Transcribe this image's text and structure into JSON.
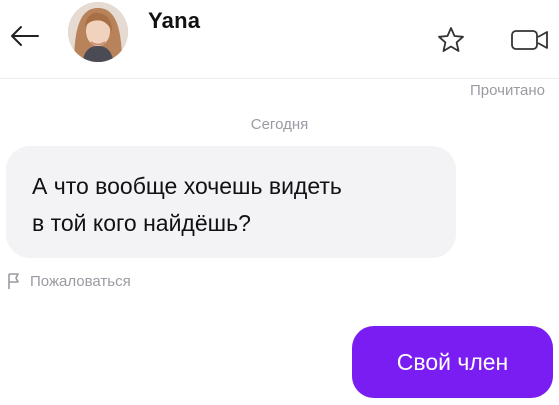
{
  "header": {
    "contact_name": "Yana",
    "back_icon": "arrow-left-icon",
    "favorite_icon": "star-icon",
    "video_call_icon": "video-camera-icon"
  },
  "chat": {
    "read_status": "Прочитано",
    "date_separator": "Сегодня",
    "incoming_message": {
      "line1": "А что вообще хочешь видеть",
      "line2": "в той кого найдёшь?"
    },
    "report_label": "Пожаловаться",
    "report_icon": "flag-icon",
    "outgoing_message": "Свой член"
  },
  "colors": {
    "accent": "#7a1df2",
    "incoming_bubble": "#f3f3f6",
    "muted_text": "#9a9aa3"
  }
}
